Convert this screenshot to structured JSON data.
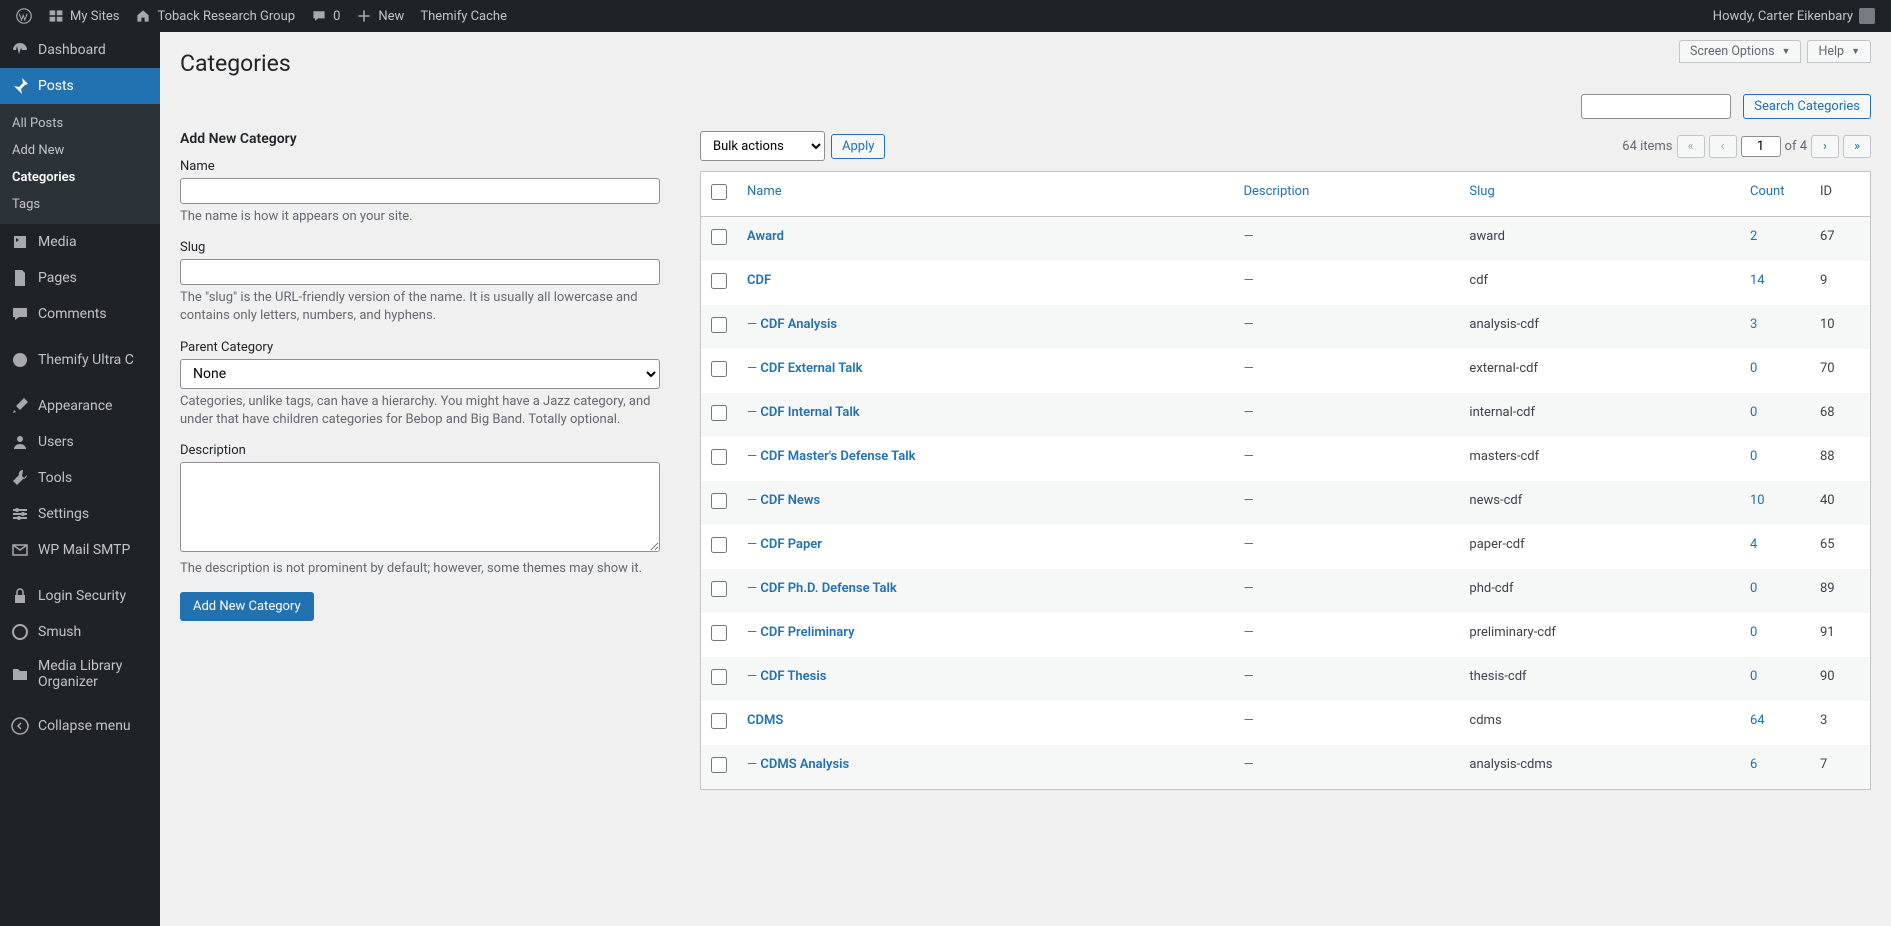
{
  "adminbar": {
    "mysites": "My Sites",
    "sitename": "Toback Research Group",
    "comments": "0",
    "new": "New",
    "themify": "Themify Cache",
    "howdy": "Howdy, Carter Eikenbary"
  },
  "sidebar": {
    "items": [
      {
        "label": "Dashboard",
        "icon": "dashboard"
      },
      {
        "label": "Posts",
        "icon": "pin",
        "active": true
      },
      {
        "label": "Media",
        "icon": "media"
      },
      {
        "label": "Pages",
        "icon": "page"
      },
      {
        "label": "Comments",
        "icon": "comment"
      },
      {
        "label": "Themify Ultra C",
        "icon": "theme"
      },
      {
        "label": "Appearance",
        "icon": "brush"
      },
      {
        "label": "Users",
        "icon": "user"
      },
      {
        "label": "Tools",
        "icon": "tool"
      },
      {
        "label": "Settings",
        "icon": "settings"
      },
      {
        "label": "WP Mail SMTP",
        "icon": "mail"
      },
      {
        "label": "Login Security",
        "icon": "lock"
      },
      {
        "label": "Smush",
        "icon": "smush"
      },
      {
        "label": "Media Library Organizer",
        "icon": "folder"
      },
      {
        "label": "Collapse menu",
        "icon": "collapse"
      }
    ],
    "submenu": [
      "All Posts",
      "Add New",
      "Categories",
      "Tags"
    ],
    "submenu_current": 2
  },
  "topactions": {
    "screen": "Screen Options",
    "help": "Help"
  },
  "page": {
    "title": "Categories"
  },
  "search": {
    "button": "Search Categories"
  },
  "form": {
    "heading": "Add New Category",
    "name_label": "Name",
    "name_help": "The name is how it appears on your site.",
    "slug_label": "Slug",
    "slug_help": "The \"slug\" is the URL-friendly version of the name. It is usually all lowercase and contains only letters, numbers, and hyphens.",
    "parent_label": "Parent Category",
    "parent_value": "None",
    "parent_help": "Categories, unlike tags, can have a hierarchy. You might have a Jazz category, and under that have children categories for Bebop and Big Band. Totally optional.",
    "desc_label": "Description",
    "desc_help": "The description is not prominent by default; however, some themes may show it.",
    "submit": "Add New Category"
  },
  "bulk": {
    "label": "Bulk actions",
    "apply": "Apply"
  },
  "pagination": {
    "total": "64 items",
    "current": "1",
    "of": "of 4"
  },
  "columns": {
    "name": "Name",
    "desc": "Description",
    "slug": "Slug",
    "count": "Count",
    "id": "ID"
  },
  "rows": [
    {
      "name": "Award",
      "indent": false,
      "desc": "—",
      "slug": "award",
      "count": "2",
      "id": "67"
    },
    {
      "name": "CDF",
      "indent": false,
      "desc": "—",
      "slug": "cdf",
      "count": "14",
      "id": "9"
    },
    {
      "name": "CDF Analysis",
      "indent": true,
      "desc": "—",
      "slug": "analysis-cdf",
      "count": "3",
      "id": "10"
    },
    {
      "name": "CDF External Talk",
      "indent": true,
      "desc": "—",
      "slug": "external-cdf",
      "count": "0",
      "id": "70"
    },
    {
      "name": "CDF Internal Talk",
      "indent": true,
      "desc": "—",
      "slug": "internal-cdf",
      "count": "0",
      "id": "68"
    },
    {
      "name": "CDF Master's Defense Talk",
      "indent": true,
      "desc": "—",
      "slug": "masters-cdf",
      "count": "0",
      "id": "88"
    },
    {
      "name": "CDF News",
      "indent": true,
      "desc": "—",
      "slug": "news-cdf",
      "count": "10",
      "id": "40"
    },
    {
      "name": "CDF Paper",
      "indent": true,
      "desc": "—",
      "slug": "paper-cdf",
      "count": "4",
      "id": "65"
    },
    {
      "name": "CDF Ph.D. Defense Talk",
      "indent": true,
      "desc": "—",
      "slug": "phd-cdf",
      "count": "0",
      "id": "89"
    },
    {
      "name": "CDF Preliminary",
      "indent": true,
      "desc": "—",
      "slug": "preliminary-cdf",
      "count": "0",
      "id": "91"
    },
    {
      "name": "CDF Thesis",
      "indent": true,
      "desc": "—",
      "slug": "thesis-cdf",
      "count": "0",
      "id": "90"
    },
    {
      "name": "CDMS",
      "indent": false,
      "desc": "—",
      "slug": "cdms",
      "count": "64",
      "id": "3"
    },
    {
      "name": "CDMS Analysis",
      "indent": true,
      "desc": "—",
      "slug": "analysis-cdms",
      "count": "6",
      "id": "7"
    }
  ]
}
